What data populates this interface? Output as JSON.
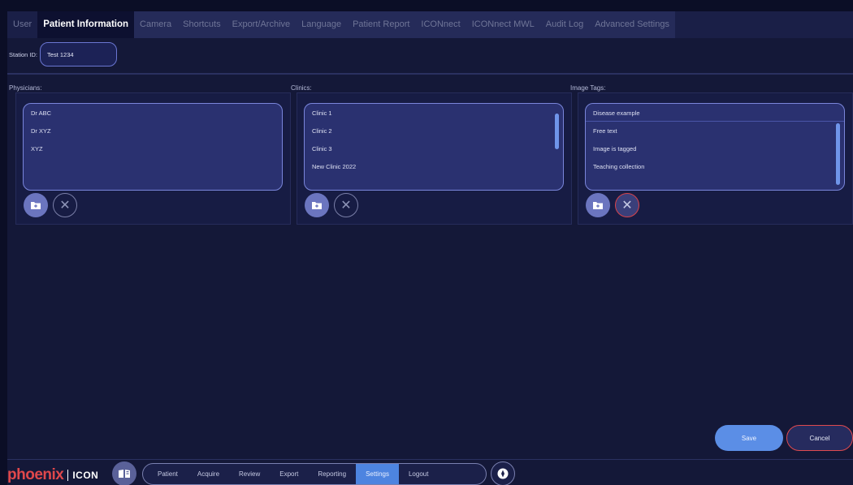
{
  "tabs": [
    {
      "label": "User"
    },
    {
      "label": "Patient Information"
    },
    {
      "label": "Camera"
    },
    {
      "label": "Shortcuts"
    },
    {
      "label": "Export/Archive"
    },
    {
      "label": "Language"
    },
    {
      "label": "Patient Report"
    },
    {
      "label": "ICONnect"
    },
    {
      "label": "ICONnect MWL"
    },
    {
      "label": "Audit Log"
    },
    {
      "label": "Advanced Settings"
    }
  ],
  "active_tab": "Patient Information",
  "station": {
    "label": "Station ID:",
    "value": "Test 1234"
  },
  "physicians": {
    "label": "Physicians:",
    "items": [
      "Dr ABC",
      "Dr XYZ",
      "XYZ"
    ]
  },
  "clinics": {
    "label": "Clinics:",
    "items": [
      "Clinic 1",
      "Clinic 2",
      "Clinic 3",
      "New Clinic 2022"
    ]
  },
  "image_tags": {
    "label": "Image Tags:",
    "items": [
      "Disease example",
      "Free text",
      "Image is tagged",
      "Teaching collection"
    ]
  },
  "actions": {
    "save": "Save",
    "cancel": "Cancel"
  },
  "logo": {
    "brand": "phoenix",
    "product": "ICON"
  },
  "nav": {
    "items": [
      "Patient",
      "Acquire",
      "Review",
      "Export",
      "Reporting",
      "Settings",
      "Logout"
    ],
    "active": "Settings"
  },
  "icons": {
    "add": "add-folder-icon",
    "remove": "close-icon",
    "bookmark": "book-icon",
    "nav_extra": "compass-icon"
  },
  "colors": {
    "accent": "#5b8ee6",
    "danger": "#e04a4f",
    "brand": "#e0484b",
    "panel": "#171c44",
    "list_bg": "#2a3170"
  }
}
